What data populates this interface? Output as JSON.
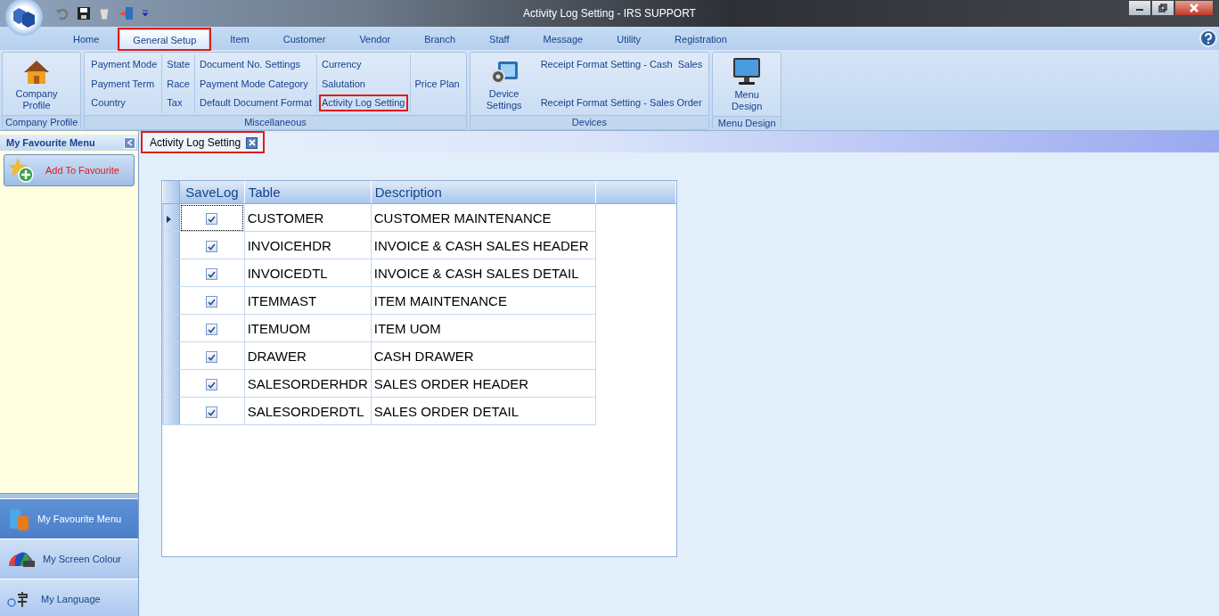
{
  "window": {
    "title": "Activity Log Setting - IRS SUPPORT"
  },
  "ribbon_tabs": [
    {
      "label": "Home",
      "selected": false,
      "highlighted": false
    },
    {
      "label": "General Setup",
      "selected": true,
      "highlighted": true
    },
    {
      "label": "Item",
      "selected": false,
      "highlighted": false
    },
    {
      "label": "Customer",
      "selected": false,
      "highlighted": false
    },
    {
      "label": "Vendor",
      "selected": false,
      "highlighted": false
    },
    {
      "label": "Branch",
      "selected": false,
      "highlighted": false
    },
    {
      "label": "Staff",
      "selected": false,
      "highlighted": false
    },
    {
      "label": "Message",
      "selected": false,
      "highlighted": false
    },
    {
      "label": "Utility",
      "selected": false,
      "highlighted": false
    },
    {
      "label": "Registration",
      "selected": false,
      "highlighted": false
    }
  ],
  "ribbon_groups": [
    {
      "label": "Company Profile",
      "big_button": {
        "label": "Company Profile",
        "kind": "house"
      }
    },
    {
      "label": "Miscellaneous",
      "columns": [
        [
          {
            "label": "Payment Mode",
            "highlighted": false
          },
          {
            "label": "Payment Term",
            "highlighted": false
          },
          {
            "label": "Country",
            "highlighted": false
          }
        ],
        [
          {
            "label": "State",
            "highlighted": false
          },
          {
            "label": "Race",
            "highlighted": false
          },
          {
            "label": "Tax",
            "highlighted": false
          }
        ],
        [
          {
            "label": "Document No. Settings",
            "highlighted": false
          },
          {
            "label": "Payment Mode Category",
            "highlighted": false
          },
          {
            "label": "Default Document Format",
            "highlighted": false
          }
        ],
        [
          {
            "label": "Currency",
            "highlighted": false
          },
          {
            "label": "Salutation",
            "highlighted": false
          },
          {
            "label": "Activity Log Setting",
            "highlighted": true
          }
        ],
        [
          {
            "label": "Price Plan",
            "highlighted": false
          }
        ]
      ]
    },
    {
      "label": "Devices",
      "big_button": {
        "label": "Device Settings",
        "kind": "device"
      },
      "columns": [
        [
          {
            "label": "Receipt Format Setting - Cash  Sales",
            "highlighted": false
          },
          {
            "label": "Receipt Format Setting - Sales Order",
            "highlighted": false
          }
        ]
      ]
    },
    {
      "label": "Menu Design",
      "big_button": {
        "label": "Menu Design",
        "kind": "monitor"
      }
    }
  ],
  "sidebar": {
    "title": "My Favourite Menu",
    "add_button": "Add To Favourite",
    "nav": [
      {
        "label": "My Favourite Menu",
        "kind": "favourite",
        "selected": true
      },
      {
        "label": "My Screen Colour",
        "kind": "colour",
        "selected": false
      },
      {
        "label": "My Language",
        "kind": "language",
        "selected": false
      }
    ]
  },
  "document_tab": {
    "label": "Activity Log Setting",
    "highlighted": true
  },
  "table": {
    "columns": [
      "SaveLog",
      "Table",
      "Description"
    ],
    "rows": [
      {
        "checked": true,
        "table": "CUSTOMER",
        "description": "CUSTOMER MAINTENANCE",
        "current": true
      },
      {
        "checked": true,
        "table": "INVOICEHDR",
        "description": "INVOICE & CASH SALES HEADER",
        "current": false
      },
      {
        "checked": true,
        "table": "INVOICEDTL",
        "description": "INVOICE & CASH SALES DETAIL",
        "current": false
      },
      {
        "checked": true,
        "table": "ITEMMAST",
        "description": "ITEM MAINTENANCE",
        "current": false
      },
      {
        "checked": true,
        "table": "ITEMUOM",
        "description": "ITEM UOM",
        "current": false
      },
      {
        "checked": true,
        "table": "DRAWER",
        "description": "CASH DRAWER",
        "current": false
      },
      {
        "checked": true,
        "table": "SALESORDERHDR",
        "description": "SALES ORDER HEADER",
        "current": false
      },
      {
        "checked": true,
        "table": "SALESORDERDTL",
        "description": "SALES ORDER DETAIL",
        "current": false
      }
    ]
  }
}
